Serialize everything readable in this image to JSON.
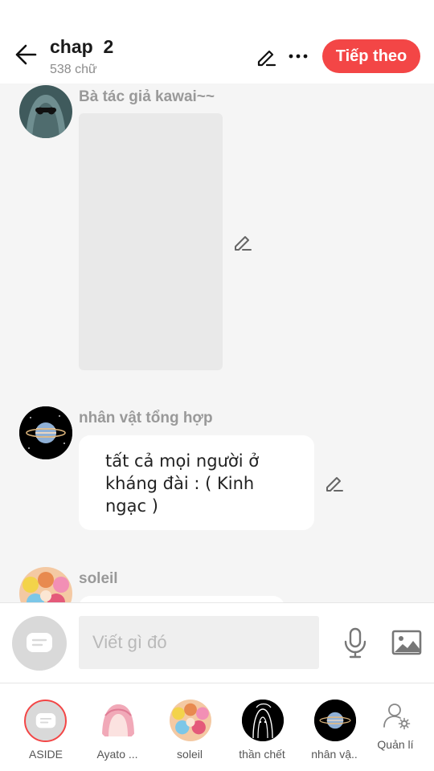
{
  "header": {
    "title": "chap  2",
    "word_count": "538 chữ",
    "next_label": "Tiếp theo",
    "back_icon": "arrow-left-icon",
    "edit_icon": "pencil-icon",
    "more_icon": "ellipsis-icon"
  },
  "messages": [
    {
      "sender": "Bà tác giả kawai~~",
      "type": "image",
      "avatar_icon": "avatar-hooded-figure"
    },
    {
      "sender": "nhân vật tổng hợp",
      "type": "text",
      "text": "tất cả mọi người ở kháng đài : ( Kinh ngạc )",
      "avatar_icon": "avatar-planet"
    },
    {
      "sender": "soleil",
      "type": "text",
      "text": "",
      "avatar_icon": "avatar-group-girls"
    }
  ],
  "composer": {
    "placeholder": "Viết gì đó",
    "aside_icon": "aside-chat-icon",
    "mic_icon": "microphone-icon",
    "image_icon": "image-icon"
  },
  "characters": [
    {
      "label": "ASIDE",
      "icon": "aside-chat-icon"
    },
    {
      "label": "Ayato ...",
      "icon": "avatar-pink-hair"
    },
    {
      "label": "soleil",
      "icon": "avatar-group-girls"
    },
    {
      "label": "thần chết",
      "icon": "avatar-reaper"
    },
    {
      "label": "nhân vậ..",
      "icon": "avatar-planet"
    },
    {
      "label": "Quản lí",
      "icon": "user-settings-icon"
    }
  ],
  "colors": {
    "accent": "#f34646",
    "background": "#f5f5f5",
    "muted_text": "#999999"
  }
}
